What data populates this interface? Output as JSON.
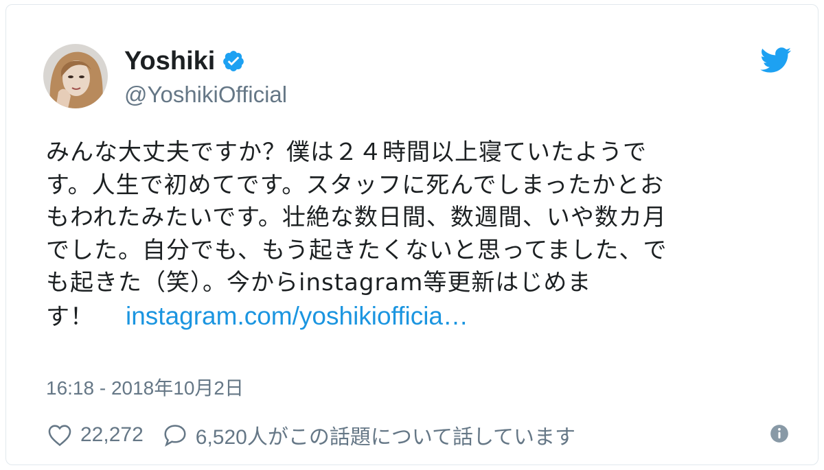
{
  "tweet": {
    "author_name": "Yoshiki",
    "author_handle": "@YoshikiOfficial",
    "text_lines": [
      "みんな大丈夫ですか？僕は２４時間以上寝ていたようで",
      "す。人生で初めてです。スタッフに死んでしまったかとお",
      "もわれたみたいです。壮絶な数日間、数週間、いや数カ月",
      "でした。自分でも、もう起きたくないと思ってました、で",
      "も起きた（笑）。今からinstagram等更新はじめま",
      "す！"
    ],
    "link_text": "instagram.com/yoshikiofficia…",
    "timestamp": "16:18 - 2018年10月2日",
    "like_count": "22,272",
    "reply_text": "6,520人がこの話題について話しています"
  },
  "colors": {
    "link": "#1b95e0",
    "verified": "#1da1f2",
    "twitter_bird": "#1da1f2",
    "muted_text": "#657786"
  },
  "icons": {
    "verified": "verified-badge-icon",
    "brand": "twitter-bird-icon",
    "like": "heart-icon",
    "reply": "speech-bubble-icon",
    "info": "info-icon"
  }
}
